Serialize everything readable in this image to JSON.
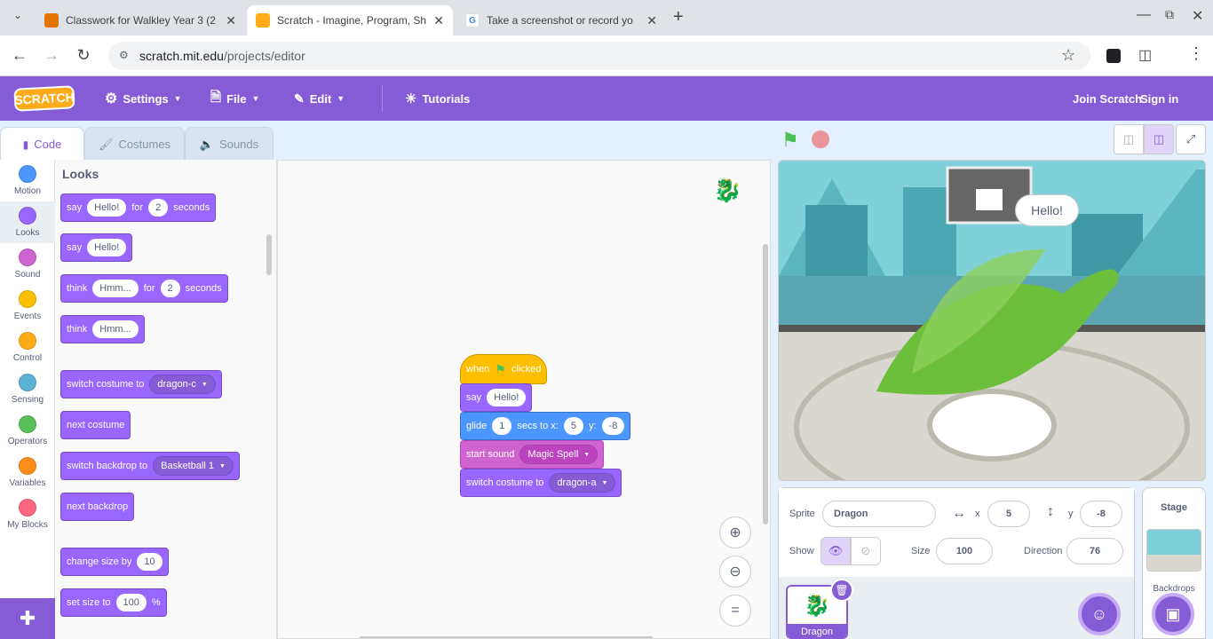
{
  "browser": {
    "tabs": [
      {
        "title": "Classwork for Walkley Year 3 (2",
        "favicon_color": "#e37400"
      },
      {
        "title": "Scratch - Imagine, Program, Sh",
        "favicon_color": "#ffab19"
      },
      {
        "title": "Take a screenshot or record yo",
        "favicon_color": "#4285f4"
      }
    ],
    "url_host": "scratch.mit.edu",
    "url_path": "/projects/editor"
  },
  "menu": {
    "logo": "SCRATCH",
    "settings": "Settings",
    "file": "File",
    "edit": "Edit",
    "tutorials": "Tutorials",
    "join": "Join Scratch",
    "signin": "Sign in"
  },
  "editor_tabs": {
    "code": "Code",
    "costumes": "Costumes",
    "sounds": "Sounds"
  },
  "categories": [
    {
      "label": "Motion",
      "color": "#4c97ff"
    },
    {
      "label": "Looks",
      "color": "#9966ff"
    },
    {
      "label": "Sound",
      "color": "#cf63cf"
    },
    {
      "label": "Events",
      "color": "#ffbf00"
    },
    {
      "label": "Control",
      "color": "#ffab19"
    },
    {
      "label": "Sensing",
      "color": "#5cb1d6"
    },
    {
      "label": "Operators",
      "color": "#59c059"
    },
    {
      "label": "Variables",
      "color": "#ff8c1a"
    },
    {
      "label": "My Blocks",
      "color": "#ff6680"
    }
  ],
  "palette": {
    "heading": "Looks",
    "say_for": {
      "say": "say",
      "msg": "Hello!",
      "for": "for",
      "secs": "2",
      "seconds": "seconds"
    },
    "say": {
      "say": "say",
      "msg": "Hello!"
    },
    "think_for": {
      "think": "think",
      "msg": "Hmm...",
      "for": "for",
      "secs": "2",
      "seconds": "seconds"
    },
    "think": {
      "think": "think",
      "msg": "Hmm..."
    },
    "switch_costume": {
      "label": "switch costume to",
      "value": "dragon-c"
    },
    "next_costume": "next costume",
    "switch_backdrop": {
      "label": "switch backdrop to",
      "value": "Basketball 1"
    },
    "next_backdrop": "next backdrop",
    "change_size": {
      "label": "change size by",
      "value": "10"
    },
    "set_size": {
      "label": "set size to",
      "value": "100",
      "unit": "%"
    }
  },
  "script": {
    "hat": {
      "when": "when",
      "clicked": "clicked"
    },
    "say": {
      "label": "say",
      "value": "Hello!"
    },
    "glide": {
      "glide": "glide",
      "secs": "1",
      "secs_to_x": "secs to x:",
      "x": "5",
      "y_label": "y:",
      "y": "-8"
    },
    "sound": {
      "label": "start sound",
      "value": "Magic Spell"
    },
    "costume": {
      "label": "switch costume to",
      "value": "dragon-a"
    }
  },
  "stage": {
    "speech": "Hello!"
  },
  "sprite_info": {
    "sprite_label": "Sprite",
    "sprite_name": "Dragon",
    "x_label": "x",
    "x": "5",
    "y_label": "y",
    "y": "-8",
    "show_label": "Show",
    "size_label": "Size",
    "size": "100",
    "direction_label": "Direction",
    "direction": "76"
  },
  "sprites": [
    {
      "name": "Dragon"
    }
  ],
  "stage_panel": {
    "title": "Stage",
    "backdrops_label": "Backdrops"
  }
}
